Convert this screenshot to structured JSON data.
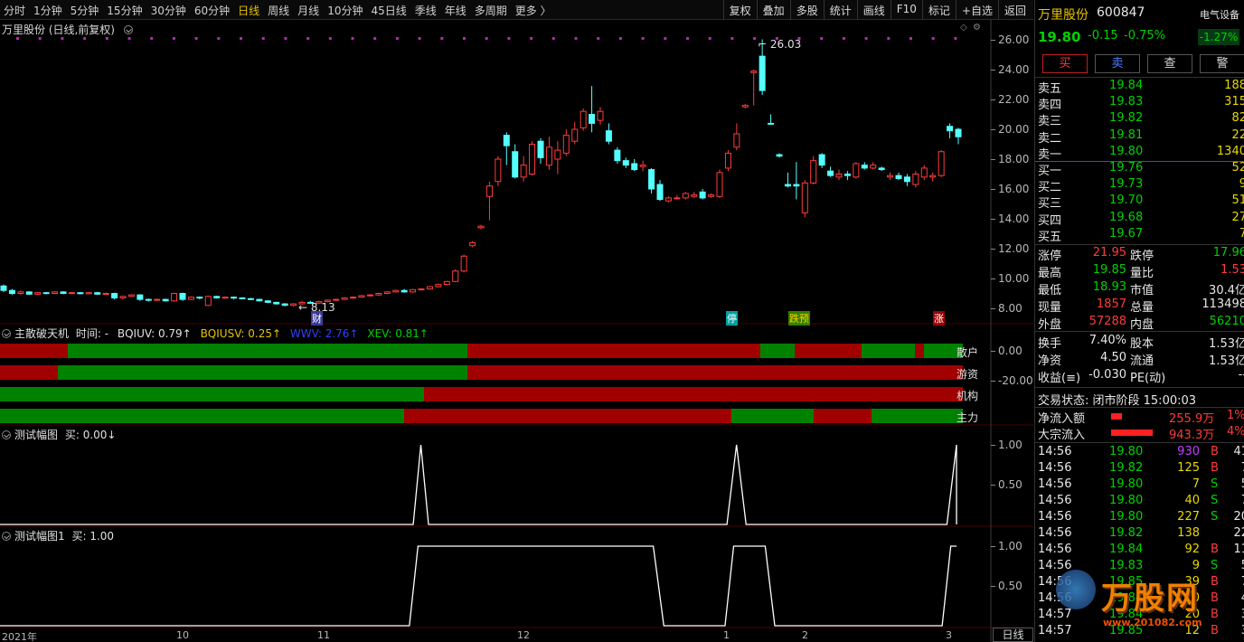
{
  "toolbar": {
    "periods": [
      "分时",
      "1分钟",
      "5分钟",
      "15分钟",
      "30分钟",
      "60分钟",
      "日线",
      "周线",
      "月线",
      "10分钟",
      "45日线",
      "季线",
      "年线",
      "多周期",
      "更多 〉"
    ],
    "active_period": "日线",
    "tools": [
      "复权",
      "叠加",
      "多股",
      "统计",
      "画线",
      "F10",
      "标记",
      "+自选",
      "返回"
    ]
  },
  "chart": {
    "title": "万里股份 (日线,前复权)",
    "high_label": "26.03",
    "low_label": "8.13",
    "y_ticks": [
      "26.00",
      "24.00",
      "22.00",
      "20.00",
      "18.00",
      "16.00",
      "14.00",
      "12.00",
      "10.00",
      "8.00"
    ],
    "markers": {
      "cai": "财",
      "ting": "停",
      "dieyu": "跌预",
      "zhang": "涨"
    }
  },
  "indicator1": {
    "title_prefix": "主散破天机",
    "time_label": "时间: -",
    "bqiuv": "BQIUV: 0.79↑",
    "bqiusv": "BQIUSV: 0.25↑",
    "wwv": "WWV: 2.76↑",
    "xev": "XEV: 0.81↑",
    "y_ticks": [
      "0.00",
      "-20.00"
    ],
    "row_labels": [
      "散户",
      "游资",
      "机构",
      "主力"
    ],
    "colors": {
      "red": "#a00000",
      "green": "#008200"
    }
  },
  "indicator2": {
    "title": "测试幅图",
    "value": "买: 0.00↓",
    "y_ticks": [
      "1.00",
      "0.50"
    ]
  },
  "indicator3": {
    "title": "测试幅图1",
    "value": "买: 1.00",
    "y_ticks": [
      "1.00",
      "0.50"
    ]
  },
  "xaxis": {
    "labels": [
      "2021年",
      "10",
      "11",
      "12",
      "1",
      "2",
      "3"
    ],
    "period_button": "日线"
  },
  "quote": {
    "name": "万里股份",
    "code": "600847",
    "sector": "电气设备",
    "sector_change": "-1.27%",
    "price": "19.80",
    "change": "-0.15",
    "change_pct": "-0.75%",
    "buttons": [
      "买",
      "卖",
      "查",
      "警"
    ],
    "asks": [
      {
        "label": "卖五",
        "price": "19.84",
        "vol": "188"
      },
      {
        "label": "卖四",
        "price": "19.83",
        "vol": "315"
      },
      {
        "label": "卖三",
        "price": "19.82",
        "vol": "82"
      },
      {
        "label": "卖二",
        "price": "19.81",
        "vol": "22"
      },
      {
        "label": "卖一",
        "price": "19.80",
        "vol": "1340"
      }
    ],
    "bids": [
      {
        "label": "买一",
        "price": "19.76",
        "vol": "52"
      },
      {
        "label": "买二",
        "price": "19.73",
        "vol": "9"
      },
      {
        "label": "买三",
        "price": "19.70",
        "vol": "51"
      },
      {
        "label": "买四",
        "price": "19.68",
        "vol": "27"
      },
      {
        "label": "买五",
        "price": "19.67",
        "vol": "7"
      }
    ],
    "stats": [
      {
        "l1": "涨停",
        "v1": "21.95",
        "c1": "red",
        "l2": "跌停",
        "v2": "17.96",
        "c2": "green"
      },
      {
        "l1": "最高",
        "v1": "19.85",
        "c1": "green",
        "l2": "量比",
        "v2": "1.53",
        "c2": "red"
      },
      {
        "l1": "最低",
        "v1": "18.93",
        "c1": "green",
        "l2": "市值",
        "v2": "30.4亿",
        "c2": "white"
      },
      {
        "l1": "现量",
        "v1": "1857",
        "c1": "red",
        "l2": "总量",
        "v2": "113498",
        "c2": "white"
      },
      {
        "l1": "外盘",
        "v1": "57288",
        "c1": "red",
        "l2": "内盘",
        "v2": "56210",
        "c2": "green"
      }
    ],
    "stats2": [
      {
        "l1": "换手",
        "v1": "7.40%",
        "l2": "股本",
        "v2": "1.53亿"
      },
      {
        "l1": "净资",
        "v1": "4.50",
        "l2": "流通",
        "v2": "1.53亿"
      },
      {
        "l1": "收益(≡)",
        "v1": "-0.030",
        "l2": "PE(动)",
        "v2": "--"
      }
    ],
    "trade_status": "交易状态: 闭市阶段 15:00:03",
    "net_inflow": {
      "label": "净流入额",
      "value": "255.9万",
      "pct": "1%"
    },
    "block_inflow": {
      "label": "大宗流入",
      "value": "943.3万",
      "pct": "4%"
    },
    "ticks": [
      {
        "t": "14:56",
        "p": "19.80",
        "v": "930",
        "s": "B",
        "n": "41"
      },
      {
        "t": "14:56",
        "p": "19.82",
        "v": "125",
        "s": "B",
        "n": "7"
      },
      {
        "t": "14:56",
        "p": "19.80",
        "v": "7",
        "s": "S",
        "n": "5"
      },
      {
        "t": "14:56",
        "p": "19.80",
        "v": "40",
        "s": "S",
        "n": "7"
      },
      {
        "t": "14:56",
        "p": "19.80",
        "v": "227",
        "s": "S",
        "n": "20"
      },
      {
        "t": "14:56",
        "p": "19.82",
        "v": "138",
        "s": "",
        "n": "22"
      },
      {
        "t": "14:56",
        "p": "19.84",
        "v": "92",
        "s": "B",
        "n": "11"
      },
      {
        "t": "14:56",
        "p": "19.83",
        "v": "9",
        "s": "S",
        "n": "5"
      },
      {
        "t": "14:56",
        "p": "19.85",
        "v": "39",
        "s": "B",
        "n": "7"
      },
      {
        "t": "14:56",
        "p": "19.84",
        "v": "10",
        "s": "B",
        "n": "4"
      },
      {
        "t": "14:57",
        "p": "19.84",
        "v": "20",
        "s": "B",
        "n": "3"
      },
      {
        "t": "14:57",
        "p": "19.85",
        "v": "12",
        "s": "B",
        "n": "3"
      }
    ]
  },
  "watermark": {
    "text": "万股网",
    "url": "www.201082.com"
  },
  "chart_data": {
    "type": "candlestick",
    "candles": [
      {
        "o": 9.5,
        "c": 9.2,
        "h": 9.6,
        "l": 9.1
      },
      {
        "o": 9.2,
        "c": 9.0,
        "h": 9.3,
        "l": 8.9
      },
      {
        "o": 9.0,
        "c": 9.1,
        "h": 9.2,
        "l": 8.9
      },
      {
        "o": 9.1,
        "c": 8.95,
        "h": 9.15,
        "l": 8.9
      },
      {
        "o": 8.95,
        "c": 9.05,
        "h": 9.1,
        "l": 8.9
      },
      {
        "o": 9.05,
        "c": 9.0,
        "h": 9.1,
        "l": 8.95
      },
      {
        "o": 9.0,
        "c": 9.1,
        "h": 9.15,
        "l": 8.95
      },
      {
        "o": 9.1,
        "c": 9.0,
        "h": 9.15,
        "l": 8.95
      },
      {
        "o": 9.0,
        "c": 9.05,
        "h": 9.1,
        "l": 8.95
      },
      {
        "o": 9.05,
        "c": 8.98,
        "h": 9.1,
        "l": 8.95
      },
      {
        "o": 8.98,
        "c": 9.05,
        "h": 9.1,
        "l": 8.95
      },
      {
        "o": 9.05,
        "c": 8.95,
        "h": 9.1,
        "l": 8.9
      },
      {
        "o": 8.95,
        "c": 9.0,
        "h": 9.05,
        "l": 8.9
      },
      {
        "o": 9.0,
        "c": 8.7,
        "h": 9.05,
        "l": 8.6
      },
      {
        "o": 8.7,
        "c": 8.8,
        "h": 8.85,
        "l": 8.6
      },
      {
        "o": 8.8,
        "c": 8.9,
        "h": 8.95,
        "l": 8.75
      },
      {
        "o": 8.9,
        "c": 8.6,
        "h": 8.95,
        "l": 8.5
      },
      {
        "o": 8.6,
        "c": 8.55,
        "h": 8.65,
        "l": 8.45
      },
      {
        "o": 8.55,
        "c": 8.6,
        "h": 8.65,
        "l": 8.5
      },
      {
        "o": 8.6,
        "c": 8.5,
        "h": 8.65,
        "l": 8.45
      },
      {
        "o": 8.5,
        "c": 9.0,
        "h": 9.05,
        "l": 8.45
      },
      {
        "o": 9.0,
        "c": 8.6,
        "h": 9.05,
        "l": 8.5
      },
      {
        "o": 8.6,
        "c": 8.75,
        "h": 8.8,
        "l": 8.55
      },
      {
        "o": 8.75,
        "c": 8.7,
        "h": 8.8,
        "l": 8.6
      },
      {
        "o": 8.2,
        "c": 8.8,
        "h": 8.85,
        "l": 8.15
      },
      {
        "o": 8.8,
        "c": 8.7,
        "h": 8.85,
        "l": 8.65
      },
      {
        "o": 8.7,
        "c": 8.75,
        "h": 8.8,
        "l": 8.65
      },
      {
        "o": 8.75,
        "c": 8.7,
        "h": 8.8,
        "l": 8.6
      },
      {
        "o": 8.7,
        "c": 8.65,
        "h": 8.75,
        "l": 8.6
      },
      {
        "o": 8.65,
        "c": 8.6,
        "h": 8.7,
        "l": 8.55
      },
      {
        "o": 8.6,
        "c": 8.5,
        "h": 8.65,
        "l": 8.45
      },
      {
        "o": 8.5,
        "c": 8.4,
        "h": 8.55,
        "l": 8.35
      },
      {
        "o": 8.4,
        "c": 8.3,
        "h": 8.45,
        "l": 8.25
      },
      {
        "o": 8.3,
        "c": 8.2,
        "h": 8.35,
        "l": 8.15
      },
      {
        "o": 8.2,
        "c": 8.3,
        "h": 8.35,
        "l": 8.13
      },
      {
        "o": 8.3,
        "c": 8.4,
        "h": 8.5,
        "l": 8.25
      },
      {
        "o": 8.4,
        "c": 8.35,
        "h": 8.5,
        "l": 8.3
      },
      {
        "o": 8.35,
        "c": 8.45,
        "h": 8.5,
        "l": 8.3
      },
      {
        "o": 8.45,
        "c": 8.55,
        "h": 8.6,
        "l": 8.4
      },
      {
        "o": 8.55,
        "c": 8.6,
        "h": 8.65,
        "l": 8.5
      },
      {
        "o": 8.6,
        "c": 8.7,
        "h": 8.75,
        "l": 8.55
      },
      {
        "o": 8.7,
        "c": 8.75,
        "h": 8.8,
        "l": 8.65
      },
      {
        "o": 8.75,
        "c": 8.85,
        "h": 8.9,
        "l": 8.7
      },
      {
        "o": 8.85,
        "c": 8.9,
        "h": 8.95,
        "l": 8.8
      },
      {
        "o": 8.9,
        "c": 9.0,
        "h": 9.05,
        "l": 8.85
      },
      {
        "o": 9.0,
        "c": 9.1,
        "h": 9.15,
        "l": 8.95
      },
      {
        "o": 9.1,
        "c": 9.2,
        "h": 9.25,
        "l": 9.05
      },
      {
        "o": 9.2,
        "c": 9.1,
        "h": 9.3,
        "l": 9.05
      },
      {
        "o": 9.1,
        "c": 9.25,
        "h": 9.3,
        "l": 9.05
      },
      {
        "o": 9.25,
        "c": 9.3,
        "h": 9.35,
        "l": 9.2
      },
      {
        "o": 9.3,
        "c": 9.45,
        "h": 9.5,
        "l": 9.25
      },
      {
        "o": 9.45,
        "c": 9.6,
        "h": 9.65,
        "l": 9.4
      },
      {
        "o": 9.6,
        "c": 9.8,
        "h": 9.85,
        "l": 9.55
      },
      {
        "o": 9.8,
        "c": 10.5,
        "h": 10.6,
        "l": 9.75
      },
      {
        "o": 10.5,
        "c": 11.5,
        "h": 11.6,
        "l": 10.4
      },
      {
        "o": 12.2,
        "c": 12.4,
        "h": 12.5,
        "l": 12.1
      },
      {
        "o": 13.4,
        "c": 13.5,
        "h": 13.6,
        "l": 13.3
      },
      {
        "o": 15.5,
        "c": 16.2,
        "h": 16.5,
        "l": 13.9
      },
      {
        "o": 16.5,
        "c": 18.0,
        "h": 18.2,
        "l": 16.2
      },
      {
        "o": 19.6,
        "c": 18.9,
        "h": 19.8,
        "l": 17.6
      },
      {
        "o": 18.5,
        "c": 16.8,
        "h": 19.0,
        "l": 16.7
      },
      {
        "o": 16.8,
        "c": 17.6,
        "h": 18.2,
        "l": 16.5
      },
      {
        "o": 17.0,
        "c": 19.0,
        "h": 19.2,
        "l": 16.9
      },
      {
        "o": 19.2,
        "c": 18.1,
        "h": 19.4,
        "l": 17.7
      },
      {
        "o": 17.6,
        "c": 18.8,
        "h": 19.5,
        "l": 17.3
      },
      {
        "o": 18.0,
        "c": 18.6,
        "h": 19.2,
        "l": 17.0
      },
      {
        "o": 18.4,
        "c": 19.6,
        "h": 20.0,
        "l": 18.2
      },
      {
        "o": 19.2,
        "c": 20.0,
        "h": 20.5,
        "l": 19.0
      },
      {
        "o": 20.1,
        "c": 21.2,
        "h": 21.4,
        "l": 19.9
      },
      {
        "o": 21.0,
        "c": 20.4,
        "h": 22.9,
        "l": 19.8
      },
      {
        "o": 20.6,
        "c": 21.2,
        "h": 21.5,
        "l": 20.3
      },
      {
        "o": 19.9,
        "c": 19.2,
        "h": 20.4,
        "l": 19.0
      },
      {
        "o": 18.6,
        "c": 17.9,
        "h": 18.8,
        "l": 17.7
      },
      {
        "o": 17.9,
        "c": 17.6,
        "h": 18.1,
        "l": 17.4
      },
      {
        "o": 17.7,
        "c": 17.3,
        "h": 18.0,
        "l": 17.2
      },
      {
        "o": 17.5,
        "c": 17.6,
        "h": 17.9,
        "l": 17.2
      },
      {
        "o": 17.3,
        "c": 16.0,
        "h": 17.4,
        "l": 15.7
      },
      {
        "o": 16.3,
        "c": 15.3,
        "h": 16.6,
        "l": 15.2
      },
      {
        "o": 15.2,
        "c": 15.4,
        "h": 15.5,
        "l": 15.1
      },
      {
        "o": 15.4,
        "c": 15.4,
        "h": 15.6,
        "l": 15.3
      },
      {
        "o": 15.4,
        "c": 15.7,
        "h": 15.8,
        "l": 15.3
      },
      {
        "o": 15.5,
        "c": 15.6,
        "h": 15.8,
        "l": 15.4
      },
      {
        "o": 15.8,
        "c": 15.4,
        "h": 16.0,
        "l": 15.3
      },
      {
        "o": 15.5,
        "c": 15.6,
        "h": 15.7,
        "l": 15.4
      },
      {
        "o": 15.5,
        "c": 17.1,
        "h": 17.3,
        "l": 15.4
      },
      {
        "o": 17.4,
        "c": 18.4,
        "h": 18.6,
        "l": 17.2
      },
      {
        "o": 18.8,
        "c": 19.7,
        "h": 20.4,
        "l": 18.6
      },
      {
        "o": 21.5,
        "c": 21.6,
        "h": 21.7,
        "l": 21.4
      },
      {
        "o": 23.8,
        "c": 23.9,
        "h": 24.0,
        "l": 21.6
      },
      {
        "o": 24.9,
        "c": 22.6,
        "h": 26.03,
        "l": 22.3
      },
      {
        "o": 20.4,
        "c": 20.35,
        "h": 21.0,
        "l": 20.3
      },
      {
        "o": 18.3,
        "c": 18.2,
        "h": 18.4,
        "l": 18.1
      },
      {
        "o": 16.3,
        "c": 16.2,
        "h": 17.1,
        "l": 16.1
      },
      {
        "o": 16.3,
        "c": 16.2,
        "h": 17.8,
        "l": 15.3
      },
      {
        "o": 14.4,
        "c": 16.4,
        "h": 16.6,
        "l": 14.1
      },
      {
        "o": 16.4,
        "c": 17.9,
        "h": 18.2,
        "l": 16.3
      },
      {
        "o": 18.3,
        "c": 17.6,
        "h": 18.4,
        "l": 17.4
      },
      {
        "o": 17.2,
        "c": 16.9,
        "h": 17.5,
        "l": 16.8
      },
      {
        "o": 16.8,
        "c": 17.0,
        "h": 17.3,
        "l": 16.6
      },
      {
        "o": 17.0,
        "c": 16.9,
        "h": 17.2,
        "l": 16.6
      },
      {
        "o": 16.8,
        "c": 17.7,
        "h": 17.8,
        "l": 16.7
      },
      {
        "o": 17.6,
        "c": 17.4,
        "h": 17.8,
        "l": 17.3
      },
      {
        "o": 17.4,
        "c": 17.6,
        "h": 17.8,
        "l": 17.3
      },
      {
        "o": 17.4,
        "c": 17.3,
        "h": 17.5,
        "l": 17.2
      },
      {
        "o": 16.8,
        "c": 16.9,
        "h": 17.1,
        "l": 16.6
      },
      {
        "o": 16.9,
        "c": 16.7,
        "h": 17.1,
        "l": 16.6
      },
      {
        "o": 16.8,
        "c": 16.5,
        "h": 17.0,
        "l": 16.2
      },
      {
        "o": 16.3,
        "c": 17.0,
        "h": 17.2,
        "l": 16.1
      },
      {
        "o": 16.8,
        "c": 17.4,
        "h": 17.6,
        "l": 16.6
      },
      {
        "o": 16.8,
        "c": 16.9,
        "h": 17.1,
        "l": 16.5
      },
      {
        "o": 16.9,
        "c": 18.5,
        "h": 18.6,
        "l": 16.8
      },
      {
        "o": 20.2,
        "c": 19.9,
        "h": 20.4,
        "l": 19.4
      },
      {
        "o": 20.0,
        "c": 19.5,
        "h": 20.1,
        "l": 19.0
      }
    ],
    "ylim": [
      8,
      27
    ],
    "indicator1_rows": [
      {
        "label": "散户",
        "segments": [
          [
            "r",
            0,
            0.07
          ],
          [
            "g",
            0.07,
            0.485
          ],
          [
            "r",
            0.485,
            0.79
          ],
          [
            "g",
            0.79,
            0.825
          ],
          [
            "r",
            0.825,
            0.895
          ],
          [
            "g",
            0.895,
            0.95
          ],
          [
            "r",
            0.95,
            0.96
          ],
          [
            "g",
            0.96,
            1.0
          ]
        ]
      },
      {
        "label": "游资",
        "segments": [
          [
            "r",
            0,
            0.06
          ],
          [
            "g",
            0.06,
            0.485
          ],
          [
            "r",
            0.485,
            1.0
          ],
          [
            "g",
            1.0,
            1.0
          ]
        ]
      },
      {
        "label": "机构",
        "segments": [
          [
            "g",
            0,
            0.44
          ],
          [
            "r",
            0.44,
            1.0
          ]
        ]
      },
      {
        "label": "主力",
        "segments": [
          [
            "g",
            0,
            0.42
          ],
          [
            "r",
            0.42,
            0.76
          ],
          [
            "g",
            0.76,
            0.845
          ],
          [
            "r",
            0.845,
            0.905
          ],
          [
            "g",
            0.905,
            1.0
          ]
        ]
      }
    ],
    "indicator2_values": [
      [
        0,
        0
      ],
      [
        0.4,
        0
      ],
      [
        0.432,
        0
      ],
      [
        0.44,
        1
      ],
      [
        0.448,
        0
      ],
      [
        0.76,
        0
      ],
      [
        0.77,
        1
      ],
      [
        0.78,
        0
      ],
      [
        0.99,
        0
      ],
      [
        1.0,
        1
      ],
      [
        1.01,
        0
      ]
    ],
    "indicator3_values": [
      [
        0,
        0
      ],
      [
        0.428,
        0
      ],
      [
        0.437,
        1
      ],
      [
        0.683,
        1
      ],
      [
        0.694,
        0
      ],
      [
        0.758,
        0
      ],
      [
        0.767,
        1
      ],
      [
        0.8,
        1
      ],
      [
        0.81,
        0
      ],
      [
        0.985,
        0
      ],
      [
        0.994,
        1
      ],
      [
        1.0,
        1
      ]
    ]
  }
}
